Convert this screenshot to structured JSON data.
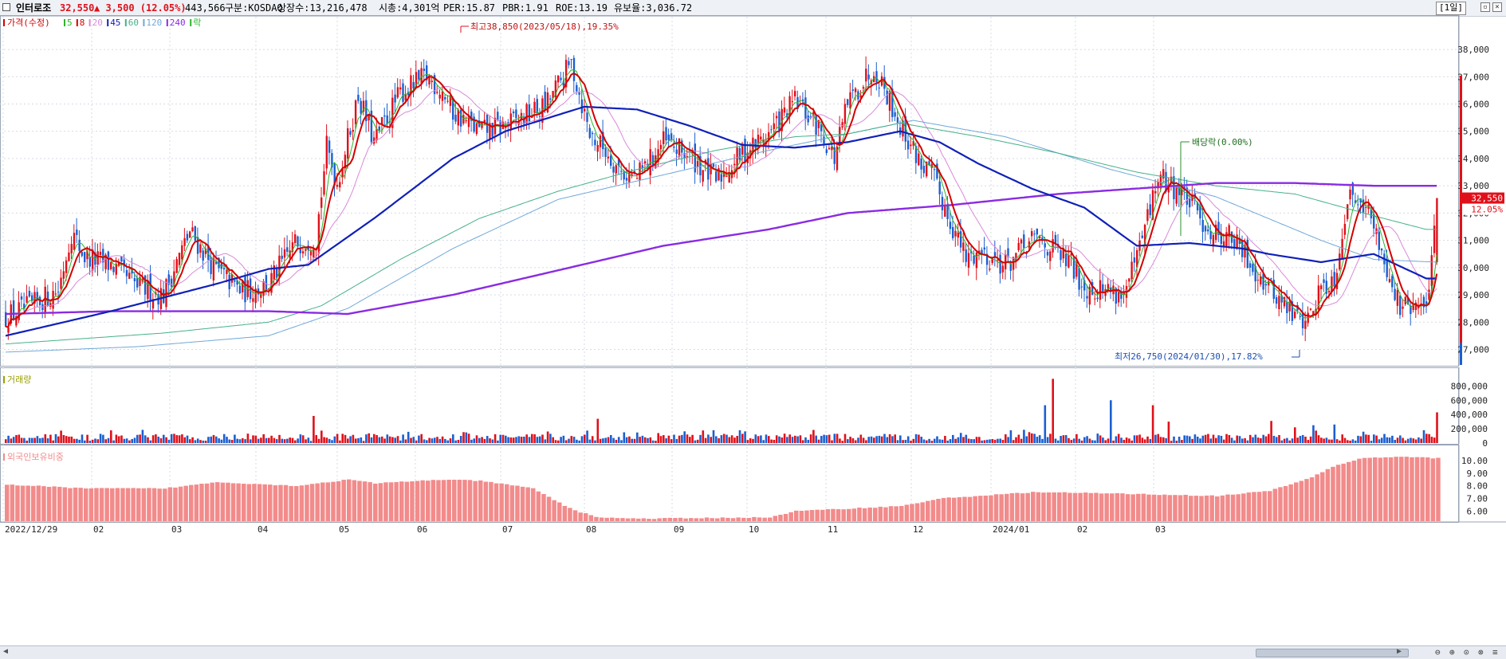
{
  "info": {
    "name": "인터로조",
    "price": "32,550",
    "change": "▲ 3,500 (12.05%)",
    "volume": "443,566",
    "market": "구분:KOSDAQ",
    "shares": "상장수:13,216,478",
    "mcap": "시총:4,301억",
    "per": "PER:15.87",
    "pbr": "PBR:1.91",
    "roe": "ROE:13.19",
    "float": "유보율:3,036.72",
    "period": "[1일]"
  },
  "colors": {
    "up": "#e0101a",
    "down": "#1b5fd0",
    "ma5": "#2cb52c",
    "ma8": "#d40000",
    "ma20": "#d98ad9",
    "ma45": "#1020b8",
    "ma60": "#45b08a",
    "ma120": "#6fa8d9",
    "ma240": "#8a2be2",
    "foreign": "#f28b8b"
  },
  "chart_data": [
    {
      "type": "candlestick",
      "legend": [
        {
          "label": "가격(수정)",
          "color": "#d40000"
        },
        {
          "label": "5",
          "color": "#2cb52c"
        },
        {
          "label": "8",
          "color": "#d40000"
        },
        {
          "label": "20",
          "color": "#d98ad9"
        },
        {
          "label": "45",
          "color": "#1020b8"
        },
        {
          "label": "60",
          "color": "#45b08a"
        },
        {
          "label": "120",
          "color": "#6fa8d9"
        },
        {
          "label": "240",
          "color": "#8a2be2"
        },
        {
          "label": "락",
          "color": "#2cb52c"
        }
      ],
      "y_ticks": [
        "38,000",
        "37,000",
        "36,000",
        "35,000",
        "34,000",
        "33,000",
        "32,000",
        "31,000",
        "30,000",
        "29,000",
        "28,000",
        "27,000"
      ],
      "ylim": [
        26400,
        39200
      ],
      "x_ticks": [
        "2022/12/29",
        "02",
        "03",
        "04",
        "05",
        "06",
        "07",
        "08",
        "09",
        "10",
        "11",
        "12",
        "2024/01",
        "02",
        "03"
      ],
      "close_path": [
        [
          0,
          28200
        ],
        [
          10,
          28600
        ],
        [
          20,
          29200
        ],
        [
          25,
          31300
        ],
        [
          30,
          30400
        ],
        [
          40,
          30100
        ],
        [
          50,
          29300
        ],
        [
          60,
          29000
        ],
        [
          65,
          30200
        ],
        [
          70,
          31300
        ],
        [
          80,
          29900
        ],
        [
          90,
          29100
        ],
        [
          100,
          29400
        ],
        [
          110,
          30900
        ],
        [
          118,
          31100
        ],
        [
          122,
          34400
        ],
        [
          126,
          33100
        ],
        [
          134,
          36300
        ],
        [
          140,
          34600
        ],
        [
          150,
          36400
        ],
        [
          160,
          37000
        ],
        [
          166,
          36500
        ],
        [
          170,
          35700
        ],
        [
          180,
          35000
        ],
        [
          190,
          35200
        ],
        [
          205,
          35900
        ],
        [
          215,
          37500
        ],
        [
          222,
          34900
        ],
        [
          228,
          34300
        ],
        [
          234,
          33500
        ],
        [
          240,
          33300
        ],
        [
          250,
          34600
        ],
        [
          260,
          34100
        ],
        [
          270,
          33200
        ],
        [
          280,
          34200
        ],
        [
          290,
          34900
        ],
        [
          300,
          36100
        ],
        [
          310,
          35000
        ],
        [
          315,
          34000
        ],
        [
          320,
          36000
        ],
        [
          330,
          37400
        ],
        [
          335,
          36400
        ],
        [
          340,
          35200
        ],
        [
          348,
          33800
        ],
        [
          352,
          33400
        ],
        [
          360,
          31500
        ],
        [
          365,
          30300
        ],
        [
          370,
          30600
        ],
        [
          380,
          30100
        ],
        [
          392,
          31100
        ],
        [
          400,
          30500
        ],
        [
          405,
          30100
        ],
        [
          410,
          29300
        ],
        [
          420,
          29200
        ],
        [
          425,
          29000
        ],
        [
          430,
          30300
        ],
        [
          438,
          33300
        ],
        [
          445,
          32900
        ],
        [
          450,
          32400
        ],
        [
          458,
          31300
        ],
        [
          465,
          31200
        ],
        [
          472,
          30300
        ],
        [
          480,
          29300
        ],
        [
          490,
          28200
        ],
        [
          495,
          28100
        ],
        [
          500,
          29300
        ],
        [
          505,
          29600
        ],
        [
          510,
          32500
        ],
        [
          515,
          32700
        ],
        [
          520,
          31500
        ],
        [
          525,
          30000
        ],
        [
          530,
          28500
        ],
        [
          536,
          28500
        ],
        [
          540,
          28500
        ],
        [
          544,
          32550
        ]
      ],
      "last_candle": {
        "open": 30200,
        "high": 32550,
        "low": 30100,
        "close": 32550
      },
      "last_price_label": "32,550",
      "last_pct_label": "12.05%",
      "annotations": [
        {
          "text": "최고38,850(2023/05/18),19.35%",
          "value": 38850
        },
        {
          "text": "최저26,750(2024/01/30),17.82%",
          "value": 26750
        },
        {
          "text": "배당락(0.00%)"
        }
      ],
      "ma_paths": {
        "ma45": [
          [
            0,
            27500
          ],
          [
            40,
            28400
          ],
          [
            80,
            29400
          ],
          [
            100,
            29950
          ],
          [
            115,
            30100
          ],
          [
            140,
            31800
          ],
          [
            170,
            34000
          ],
          [
            190,
            35000
          ],
          [
            220,
            35900
          ],
          [
            240,
            35800
          ],
          [
            260,
            35200
          ],
          [
            280,
            34500
          ],
          [
            300,
            34400
          ],
          [
            320,
            34600
          ],
          [
            340,
            35000
          ],
          [
            355,
            34600
          ],
          [
            370,
            33800
          ],
          [
            390,
            32900
          ],
          [
            410,
            32200
          ],
          [
            420,
            31500
          ],
          [
            430,
            30800
          ],
          [
            450,
            30900
          ],
          [
            470,
            30700
          ],
          [
            480,
            30500
          ],
          [
            500,
            30200
          ],
          [
            520,
            30500
          ],
          [
            540,
            29600
          ],
          [
            544,
            29600
          ]
        ],
        "ma60": [
          [
            0,
            27200
          ],
          [
            60,
            27600
          ],
          [
            100,
            28000
          ],
          [
            120,
            28600
          ],
          [
            150,
            30300
          ],
          [
            180,
            31800
          ],
          [
            210,
            32800
          ],
          [
            240,
            33600
          ],
          [
            270,
            34300
          ],
          [
            300,
            34800
          ],
          [
            320,
            34900
          ],
          [
            340,
            35300
          ],
          [
            370,
            34800
          ],
          [
            400,
            34200
          ],
          [
            430,
            33500
          ],
          [
            460,
            33000
          ],
          [
            490,
            32700
          ],
          [
            520,
            31900
          ],
          [
            540,
            31400
          ],
          [
            544,
            31400
          ]
        ],
        "ma120": [
          [
            0,
            26900
          ],
          [
            50,
            27100
          ],
          [
            100,
            27500
          ],
          [
            130,
            28500
          ],
          [
            170,
            30700
          ],
          [
            210,
            32500
          ],
          [
            250,
            33400
          ],
          [
            290,
            34300
          ],
          [
            320,
            34900
          ],
          [
            345,
            35400
          ],
          [
            380,
            34800
          ],
          [
            420,
            33600
          ],
          [
            460,
            32600
          ],
          [
            500,
            31000
          ],
          [
            520,
            30300
          ],
          [
            544,
            30200
          ]
        ],
        "ma240": [
          [
            0,
            28300
          ],
          [
            40,
            28400
          ],
          [
            80,
            28400
          ],
          [
            100,
            28400
          ],
          [
            130,
            28300
          ],
          [
            170,
            29000
          ],
          [
            210,
            29900
          ],
          [
            250,
            30800
          ],
          [
            290,
            31400
          ],
          [
            320,
            32000
          ],
          [
            360,
            32300
          ],
          [
            400,
            32700
          ],
          [
            430,
            32900
          ],
          [
            460,
            33100
          ],
          [
            490,
            33100
          ],
          [
            520,
            33000
          ],
          [
            544,
            33000
          ]
        ]
      }
    },
    {
      "type": "bar",
      "legend": [
        {
          "label": "거래량",
          "color": "#9aa000"
        }
      ],
      "y_ticks": [
        "800,000",
        "600,000",
        "400,000",
        "200,000",
        "0"
      ],
      "ylim": [
        0,
        960000
      ],
      "spikes": [
        [
          117,
          380000
        ],
        [
          225,
          340000
        ],
        [
          395,
          530000
        ],
        [
          420,
          600000
        ],
        [
          436,
          530000
        ],
        [
          442,
          300000
        ],
        [
          481,
          310000
        ],
        [
          490,
          220000
        ],
        [
          497,
          250000
        ],
        [
          505,
          260000
        ],
        [
          544,
          430000
        ],
        [
          398,
          900000
        ]
      ],
      "baseline_range": [
        30000,
        130000
      ]
    },
    {
      "type": "bar",
      "legend": [
        {
          "label": "외국인보유비중",
          "color": "#f28b8b"
        }
      ],
      "y_ticks": [
        "10.00",
        "9.00",
        "8.00",
        "7.00",
        "6.00"
      ],
      "ylim": [
        5.2,
        10.7
      ],
      "path": [
        [
          0,
          8.1
        ],
        [
          30,
          7.8
        ],
        [
          60,
          7.8
        ],
        [
          80,
          8.3
        ],
        [
          110,
          8.0
        ],
        [
          130,
          8.5
        ],
        [
          140,
          8.2
        ],
        [
          165,
          8.5
        ],
        [
          180,
          8.4
        ],
        [
          200,
          7.8
        ],
        [
          215,
          6.1
        ],
        [
          225,
          5.5
        ],
        [
          240,
          5.4
        ],
        [
          290,
          5.5
        ],
        [
          300,
          6.0
        ],
        [
          340,
          6.4
        ],
        [
          355,
          7.0
        ],
        [
          390,
          7.5
        ],
        [
          420,
          7.4
        ],
        [
          460,
          7.2
        ],
        [
          480,
          7.6
        ],
        [
          495,
          8.6
        ],
        [
          505,
          9.6
        ],
        [
          515,
          10.2
        ],
        [
          530,
          10.3
        ],
        [
          544,
          10.2
        ]
      ]
    }
  ]
}
